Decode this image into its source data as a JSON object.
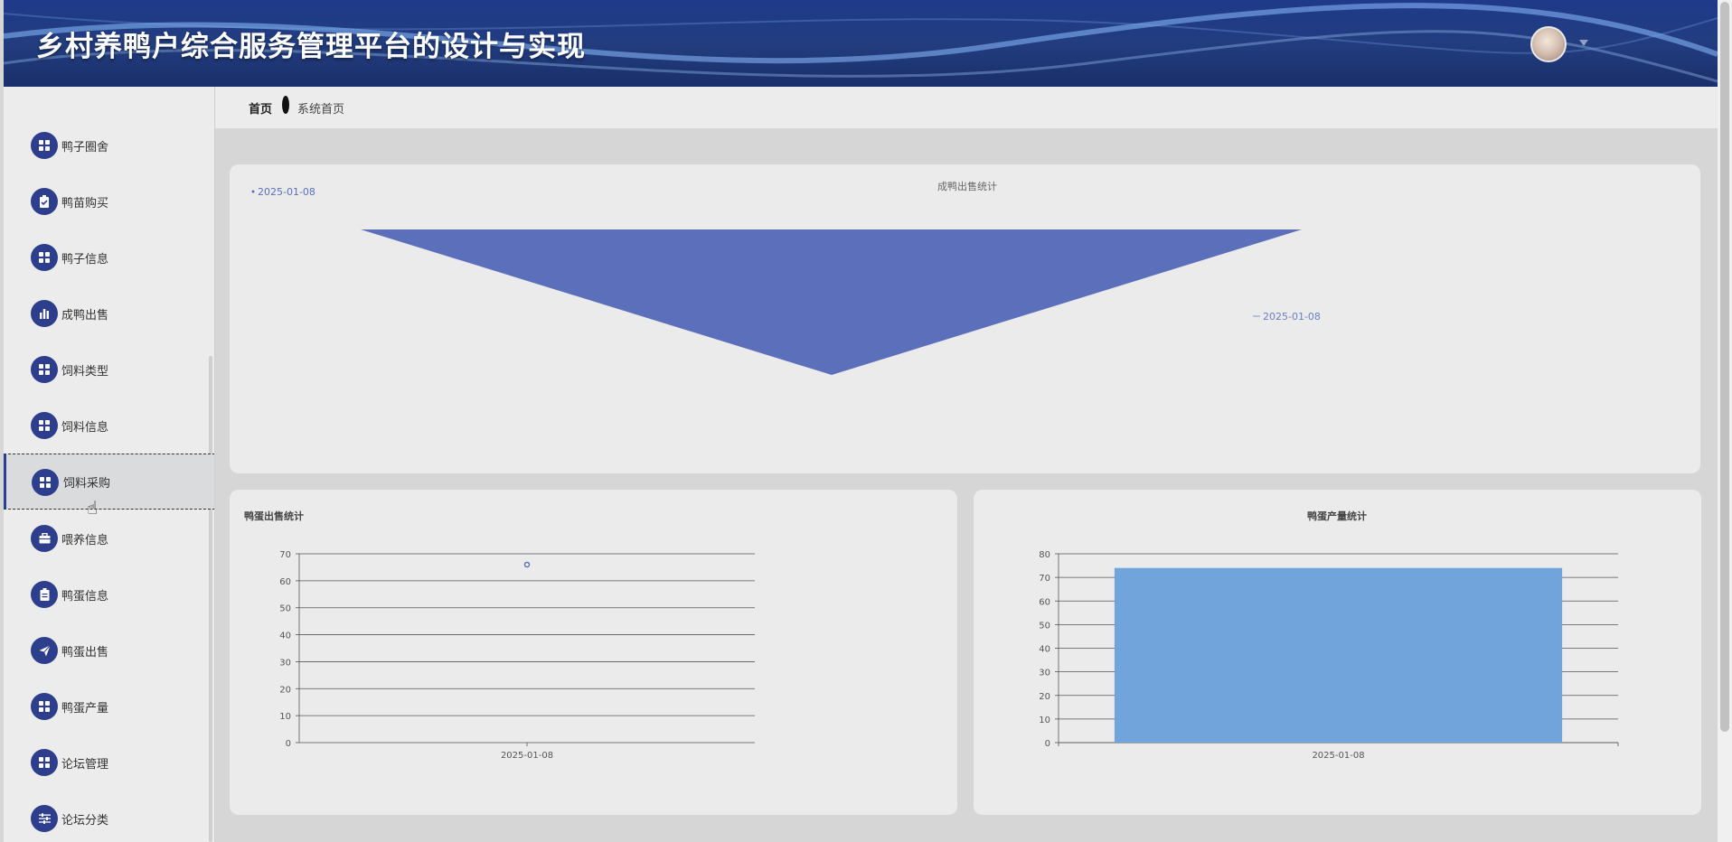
{
  "header": {
    "title": "乡村养鸭户综合服务管理平台的设计与实现",
    "avatar_icon": "user-avatar",
    "caret_icon": "caret-down-icon"
  },
  "sidebar": {
    "items": [
      {
        "label": "鸭子圈舍",
        "icon": "grid-icon"
      },
      {
        "label": "鸭苗购买",
        "icon": "clipboard-check-icon"
      },
      {
        "label": "鸭子信息",
        "icon": "grid-icon"
      },
      {
        "label": "成鸭出售",
        "icon": "bar-chart-icon"
      },
      {
        "label": "饲料类型",
        "icon": "grid-icon"
      },
      {
        "label": "饲料信息",
        "icon": "grid-icon"
      },
      {
        "label": "饲料采购",
        "icon": "grid-icon",
        "active": true
      },
      {
        "label": "喂养信息",
        "icon": "briefcase-icon"
      },
      {
        "label": "鸭蛋信息",
        "icon": "clipboard-icon"
      },
      {
        "label": "鸭蛋出售",
        "icon": "send-icon"
      },
      {
        "label": "鸭蛋产量",
        "icon": "grid-icon"
      },
      {
        "label": "论坛管理",
        "icon": "grid-icon"
      },
      {
        "label": "论坛分类",
        "icon": "sliders-icon"
      }
    ]
  },
  "breadcrumb": {
    "home": "首页",
    "current": "系统首页"
  },
  "colors": {
    "accent": "#2d3f8c",
    "funnel": "#5b6fbb",
    "bar": "#70a4da"
  },
  "chart_data": [
    {
      "type": "funnel",
      "title": "成鸭出售统计",
      "legend": [
        "2025-01-08"
      ],
      "legend_position": "top-left",
      "categories": [
        "2025-01-08"
      ],
      "label": "2025-01-08",
      "values": [
        1
      ]
    },
    {
      "type": "line",
      "title": "鸭蛋出售统计",
      "x": [
        "2025-01-08"
      ],
      "values": [
        66
      ],
      "ylim": [
        0,
        70
      ],
      "yticks": [
        "0",
        "10",
        "20",
        "30",
        "40",
        "50",
        "60",
        "70"
      ],
      "grid": true
    },
    {
      "type": "bar",
      "title": "鸭蛋产量统计",
      "categories": [
        "2025-01-08"
      ],
      "values": [
        74
      ],
      "ylim": [
        0,
        80
      ],
      "yticks": [
        "0",
        "10",
        "20",
        "30",
        "40",
        "50",
        "60",
        "70",
        "80"
      ],
      "grid": true
    }
  ]
}
